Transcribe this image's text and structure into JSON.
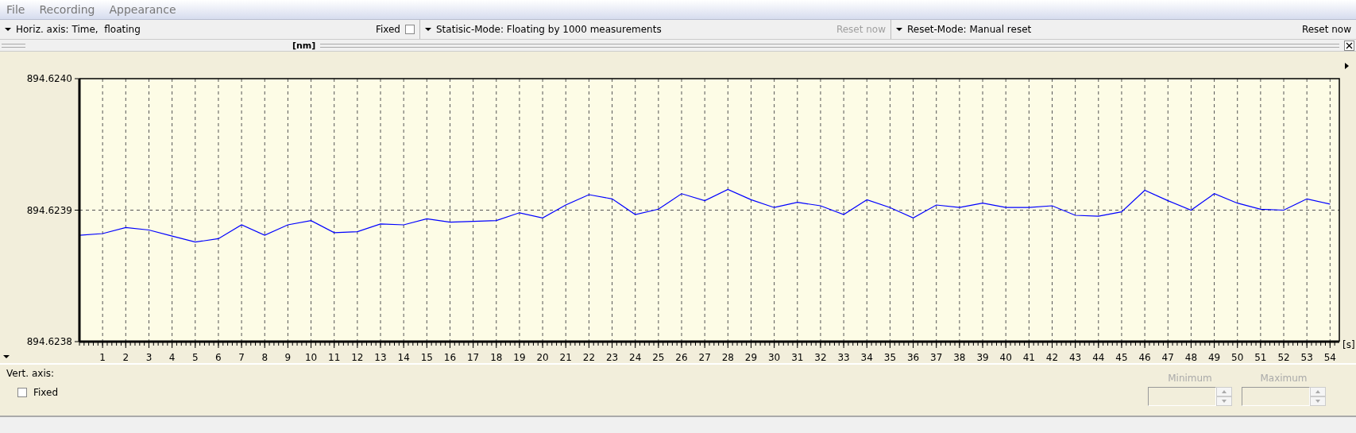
{
  "menu": [
    {
      "label": "File"
    },
    {
      "label": "Recording"
    },
    {
      "label": "Appearance"
    }
  ],
  "toolbar": {
    "horiz_axis": "Horiz. axis: Time,  floating",
    "fixed": {
      "label": "Fixed",
      "checked": false
    },
    "statistic_mode": "Statisic-Mode: Floating by 1000 measurements",
    "statistic_reset": {
      "label": "Reset now",
      "disabled": true
    },
    "reset_mode": "Reset-Mode: Manual reset",
    "manual_reset": {
      "label": "Reset now",
      "disabled": false
    }
  },
  "chart": {
    "chart_data": {
      "type": "line",
      "grid": true,
      "xlabel": "[s]",
      "ylabel": "[nm]",
      "xlim": [
        0,
        54.4
      ],
      "ylim": [
        894.6238,
        894.624
      ],
      "yticks": [
        {
          "value": 894.6238,
          "label": "894.6238"
        },
        {
          "value": 894.6239,
          "label": "894.6239"
        },
        {
          "value": 894.624,
          "label": "894.6240"
        }
      ],
      "xticks": [
        1,
        2,
        3,
        4,
        5,
        6,
        7,
        8,
        9,
        10,
        11,
        12,
        13,
        14,
        15,
        16,
        17,
        18,
        19,
        20,
        21,
        22,
        23,
        24,
        25,
        26,
        27,
        28,
        29,
        30,
        31,
        32,
        33,
        34,
        35,
        36,
        37,
        38,
        39,
        40,
        41,
        42,
        43,
        44,
        45,
        46,
        47,
        48,
        49,
        50,
        51,
        52,
        53,
        54
      ],
      "x": [
        0,
        1,
        2,
        3,
        4,
        5,
        6,
        7,
        8,
        9,
        10,
        11,
        12,
        13,
        14,
        15,
        16,
        17,
        18,
        19,
        20,
        21,
        22,
        23,
        24,
        25,
        26,
        27,
        28,
        29,
        30,
        31,
        32,
        33,
        34,
        35,
        36,
        37,
        38,
        39,
        40,
        41,
        42,
        43,
        44,
        45,
        46,
        47,
        48,
        49,
        50,
        51,
        52,
        53,
        54
      ],
      "series": [
        {
          "color": "#0000ff",
          "values": [
            894.6238809,
            894.6238822,
            894.6238868,
            894.6238849,
            894.6238803,
            894.6238757,
            894.6238783,
            894.6238888,
            894.6238809,
            894.6238888,
            894.6238921,
            894.6238829,
            894.6238836,
            894.6238895,
            894.6238888,
            894.6238934,
            894.6238908,
            894.6238914,
            894.6238921,
            894.623898,
            894.6238941,
            894.6239039,
            894.6239118,
            894.6239086,
            894.6238967,
            894.6239007,
            894.6239125,
            894.6239072,
            894.6239158,
            894.6239079,
            894.623902,
            894.6239059,
            894.6239033,
            894.6238967,
            894.6239079,
            894.623902,
            894.6238941,
            894.6239039,
            894.623902,
            894.6239053,
            894.623902,
            894.623902,
            894.6239033,
            894.6238961,
            894.6238954,
            894.6238987,
            894.6239151,
            894.6239072,
            894.6239,
            894.6239125,
            894.6239053,
            894.6239007,
            894.6239,
            894.6239086,
            894.6239046
          ]
        }
      ]
    }
  },
  "vert_axis": {
    "label": "Vert. axis:",
    "fixed": {
      "label": "Fixed",
      "checked": false
    },
    "minimum": {
      "label": "Minimum",
      "disabled": true
    },
    "maximum": {
      "label": "Maximum",
      "disabled": true
    }
  }
}
